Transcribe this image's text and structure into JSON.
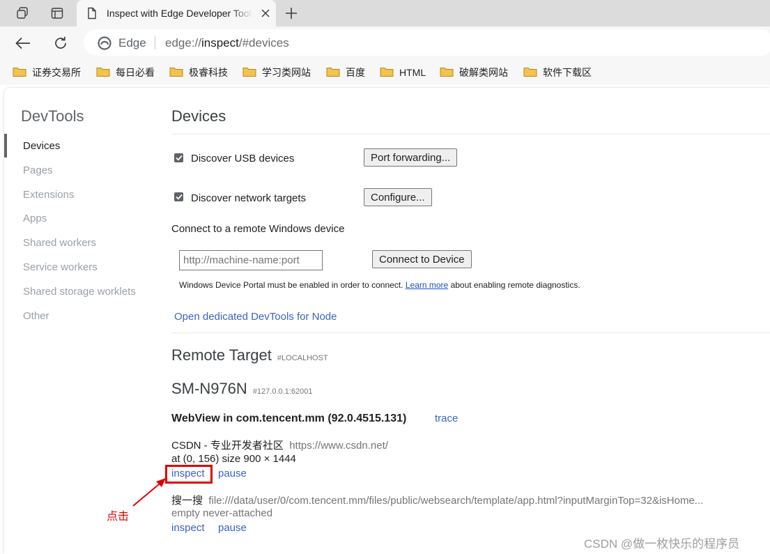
{
  "browser": {
    "tab_title": "Inspect with Edge Developer Tools",
    "omnibox_label": "Edge",
    "url_scheme": "edge://",
    "url_host": "inspect",
    "url_path": "/#devices"
  },
  "bookmarks": [
    "证券交易所",
    "每日必看",
    "极睿科技",
    "学习类网站",
    "百度",
    "HTML",
    "破解类网站",
    "软件下载区"
  ],
  "sidebar": {
    "title": "DevTools",
    "items": [
      {
        "label": "Devices",
        "active": true
      },
      {
        "label": "Pages"
      },
      {
        "label": "Extensions"
      },
      {
        "label": "Apps"
      },
      {
        "label": "Shared workers"
      },
      {
        "label": "Service workers"
      },
      {
        "label": "Shared storage worklets"
      },
      {
        "label": "Other"
      }
    ]
  },
  "devices": {
    "title": "Devices",
    "usb_label": "Discover USB devices",
    "usb_checked": true,
    "port_forwarding_button": "Port forwarding...",
    "network_label": "Discover network targets",
    "network_checked": true,
    "configure_button": "Configure...",
    "remote_windows_label": "Connect to a remote Windows device",
    "machine_placeholder": "http://machine-name:port",
    "connect_button": "Connect to Device",
    "portal_note_before": "Windows Device Portal must be enabled in order to connect.",
    "portal_note_link": "Learn more",
    "portal_note_after": "about enabling remote diagnostics.",
    "node_link": "Open dedicated DevTools for Node"
  },
  "remote": {
    "title": "Remote Target",
    "subtitle": "#LOCALHOST",
    "device_name": "SM-N976N",
    "device_addr": "#127.0.0.1:62001",
    "webview_title": "WebView in com.tencent.mm (92.0.4515.131)",
    "trace_link": "trace",
    "targets": [
      {
        "name": "CSDN - 专业开发者社区",
        "url": "https://www.csdn.net/",
        "info": "at (0, 156)  size 900 × 1444",
        "inspect": "inspect",
        "pause": "pause"
      },
      {
        "name": "搜一搜",
        "url": "file:///data/user/0/com.tencent.mm/files/public/websearch/template/app.html?inputMarginTop=32&isHome...",
        "info": "empty never-attached",
        "inspect": "inspect",
        "pause": "pause"
      }
    ]
  },
  "annotation": {
    "label": "点击",
    "color": "#e00000"
  },
  "watermark": "CSDN @做一枚快乐的程序员",
  "colors": {
    "link": "#3a62c8",
    "tabstrip": "#dcdcdc",
    "toolbar": "#f7f7f7",
    "folder": "#f3c24f"
  }
}
